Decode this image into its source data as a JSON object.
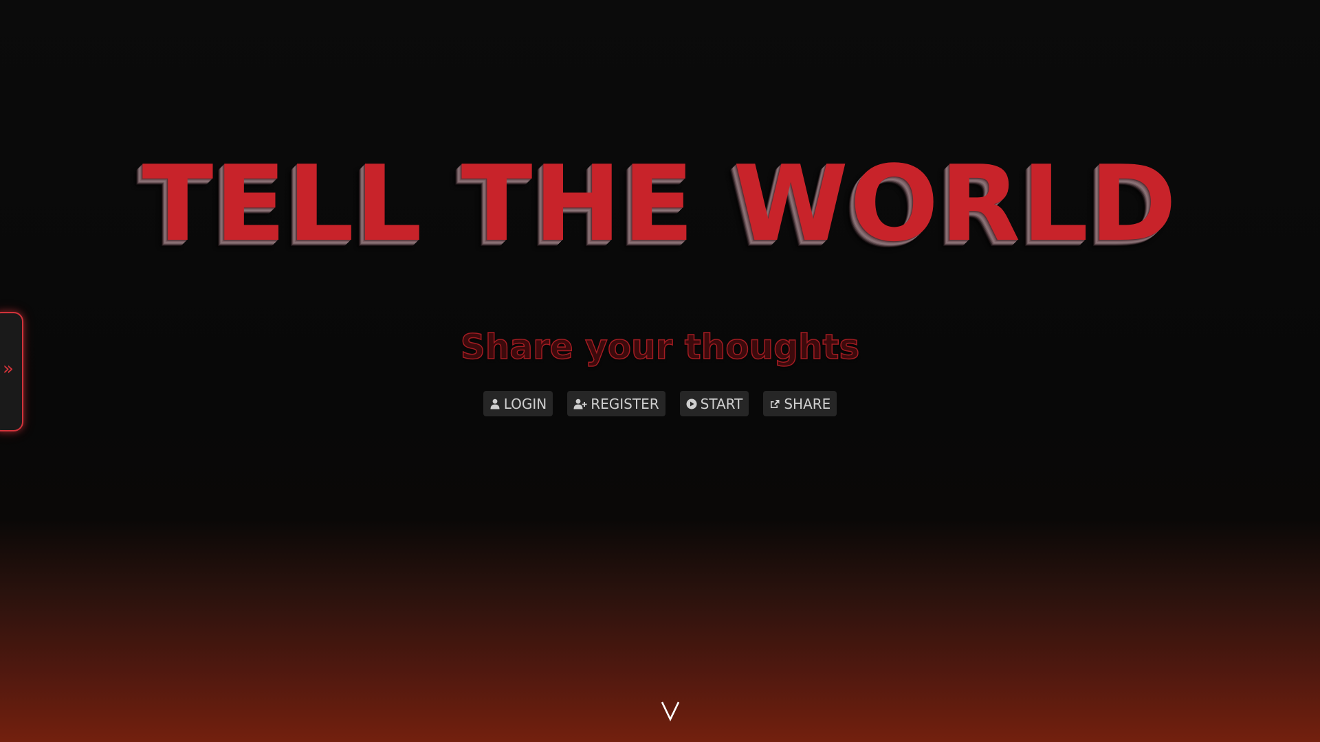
{
  "side_tab": {
    "chevron": "»",
    "icon": "double-chevron-right-icon"
  },
  "hero": {
    "title": "TELL THE WORLD",
    "subtitle": "Share your thoughts"
  },
  "buttons": [
    {
      "label": "LOGIN",
      "icon": "user-icon"
    },
    {
      "label": "REGISTER",
      "icon": "user-plus-icon"
    },
    {
      "label": "START",
      "icon": "play-circle-icon"
    },
    {
      "label": "SHARE",
      "icon": "share-icon"
    }
  ],
  "scroll": {
    "icon": "chevron-down-icon"
  },
  "colors": {
    "accent": "#c8232a",
    "button_bg": "#262626",
    "button_text": "#cfcfcf",
    "bottom_glow": "#73200e"
  }
}
